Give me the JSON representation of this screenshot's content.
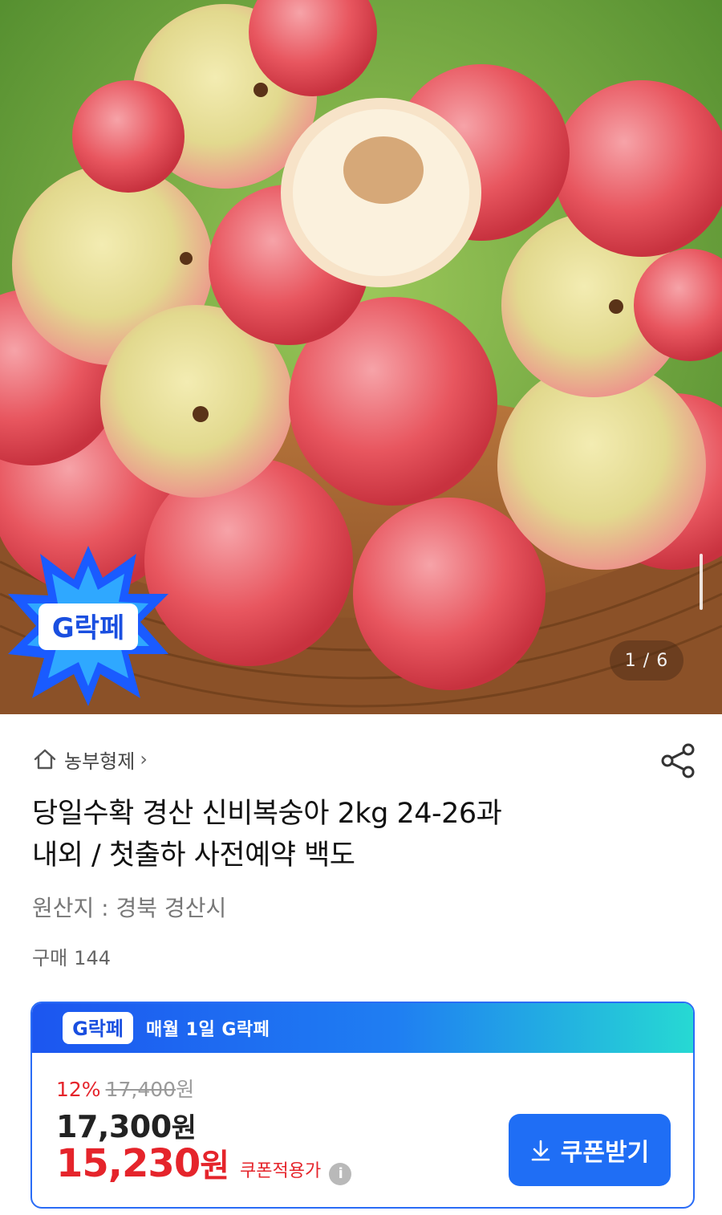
{
  "gallery": {
    "counter": "1 / 6",
    "badge_text": "G락페"
  },
  "seller": {
    "name": "농부형제"
  },
  "product": {
    "title_line1": "당일수확 경산 신비복숭아 2kg 24-26과",
    "title_line2": "내외 / 첫출하 사전예약 백도",
    "origin": "원산지 : 경북 경산시",
    "purchase_label": "구매",
    "purchase_count": "144"
  },
  "promo_card": {
    "badge_text": "G락페",
    "headline": "매월 1일 G락페",
    "discount_rate": "12%",
    "original_price": "17,400",
    "original_unit": "원",
    "sale_price": "17,300",
    "sale_unit": "원",
    "final_price": "15,230",
    "final_unit": "원",
    "final_note": "쿠폰적용가",
    "info_icon": "i",
    "button_label": "쿠폰받기"
  },
  "colors": {
    "accent_blue": "#1f6ef5",
    "price_red": "#e5242b",
    "gradient_end": "#26d9d3"
  },
  "icons": [
    "home-icon",
    "share-icon",
    "info-icon",
    "download-icon",
    "chevron-right-icon"
  ]
}
